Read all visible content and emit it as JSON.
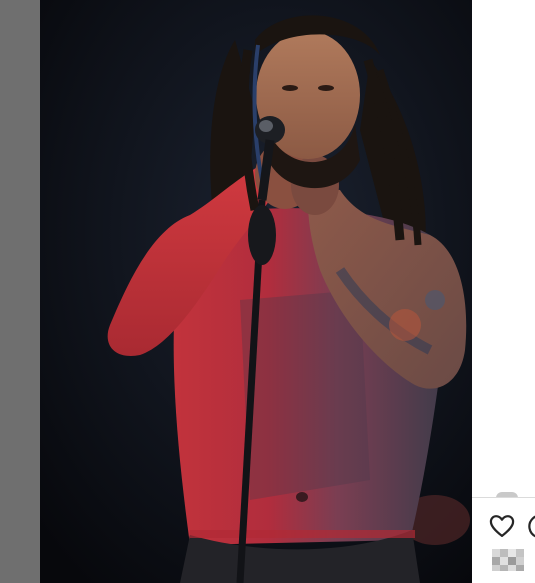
{
  "post": {
    "media_type": "photo",
    "actions": {
      "like_icon": "heart-outline-icon",
      "comment_icon": "speech-bubble-icon"
    }
  },
  "colors": {
    "left_strip": "#6f6f6f",
    "photo_background": "#0f1118",
    "body_paint_red": "#b8323a",
    "panel_background": "#ffffff",
    "icon_stroke": "#262626"
  }
}
